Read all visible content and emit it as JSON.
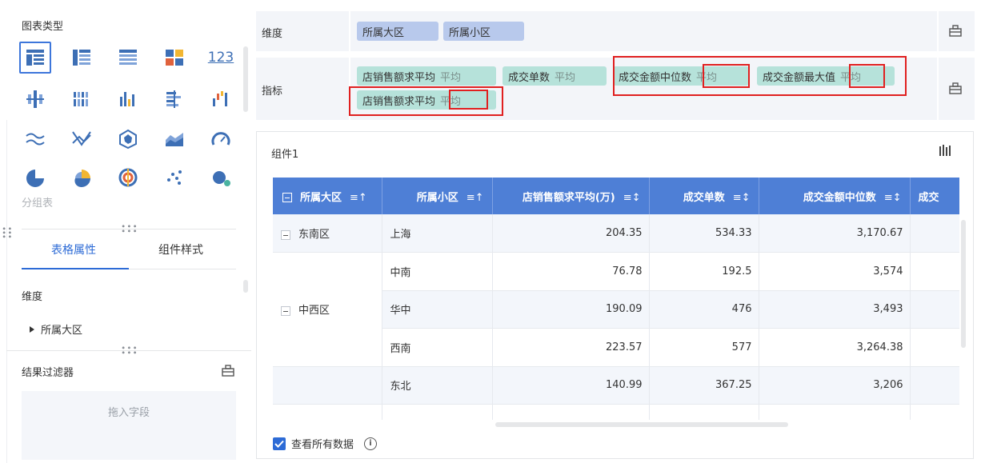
{
  "left_panel": {
    "chart_type_title": "图表类型",
    "group_table_label": "分组表",
    "tabs": [
      {
        "label": "表格属性",
        "active": true
      },
      {
        "label": "组件样式",
        "active": false
      }
    ],
    "dimension_label": "维度",
    "dimension_tree": [
      {
        "label": "所属大区",
        "expanded": false
      }
    ],
    "result_filter_title": "结果过滤器",
    "drop_placeholder": "拖入字段",
    "accent_color": "#2d6bd6"
  },
  "config": {
    "dimension_row_label": "维度",
    "dimension_pills": [
      {
        "label": "所属大区"
      },
      {
        "label": "所属小区"
      }
    ],
    "indicator_row_label": "指标",
    "indicator_pills": [
      {
        "label": "店销售额求平均",
        "agg": "平均"
      },
      {
        "label": "成交单数",
        "agg": "平均"
      },
      {
        "label": "成交金额中位数",
        "agg": "平均"
      },
      {
        "label": "成交金额最大值",
        "agg": "平均"
      },
      {
        "label": "店销售额求平均",
        "agg": "平均"
      }
    ],
    "highlight_color": "#e02020"
  },
  "component": {
    "title": "组件1",
    "columns": [
      "所属大区",
      "所属小区",
      "店销售额求平均(万)",
      "成交单数",
      "成交金额中位数",
      "成交"
    ],
    "header_color": "#4e7fd6",
    "rows": [
      {
        "region": "东南区",
        "sub": "上海",
        "avg_sales": "204.35",
        "orders": "534.33",
        "median": "3,170.67"
      },
      {
        "region": "中西区",
        "sub": "中南",
        "avg_sales": "76.78",
        "orders": "192.5",
        "median": "3,574"
      },
      {
        "region": "",
        "sub": "华中",
        "avg_sales": "190.09",
        "orders": "476",
        "median": "3,493"
      },
      {
        "region": "",
        "sub": "西南",
        "avg_sales": "223.57",
        "orders": "577",
        "median": "3,264.38"
      },
      {
        "region": "",
        "sub": "东北",
        "avg_sales": "140.99",
        "orders": "367.25",
        "median": "3,206"
      }
    ],
    "view_all_label": "查看所有数据",
    "view_all_checked": true
  }
}
